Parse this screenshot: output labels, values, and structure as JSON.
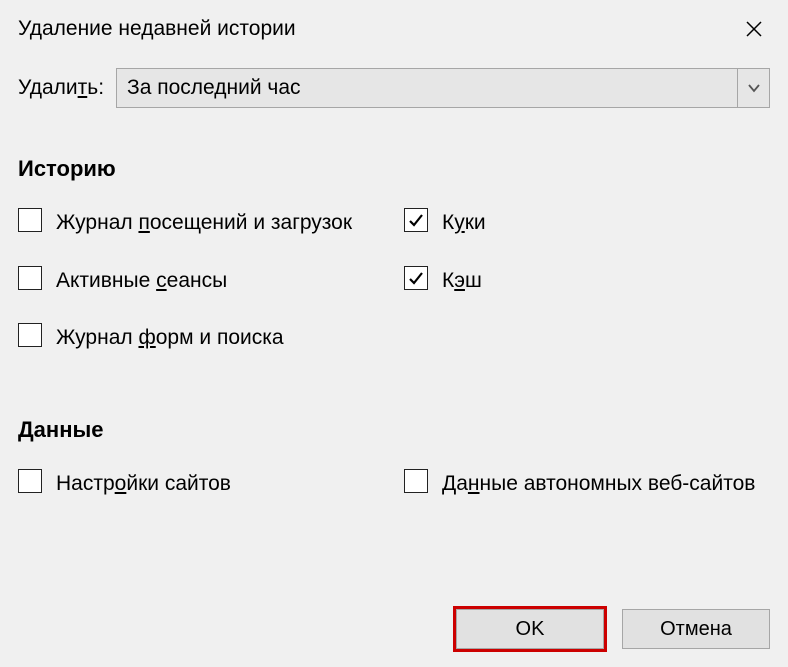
{
  "dialog": {
    "title": "Удаление недавней истории",
    "delete_label": "Удалить:",
    "range_value": "За последний час"
  },
  "sections": {
    "history_title": "Историю",
    "data_title": "Данные"
  },
  "checkboxes": {
    "browsing": {
      "label": "Журнал посещений и загрузок",
      "underline_char": "п",
      "checked": false
    },
    "sessions": {
      "label": "Активные сеансы",
      "underline_char": "с",
      "checked": false
    },
    "forms": {
      "label": "Журнал форм и поиска",
      "underline_char": "ф",
      "checked": false
    },
    "cookies": {
      "label": "Куки",
      "underline_char": "у",
      "checked": true
    },
    "cache": {
      "label": "Кэш",
      "underline_char": "э",
      "checked": true
    },
    "site_settings": {
      "label": "Настройки сайтов",
      "underline_char": "о",
      "checked": false
    },
    "offline": {
      "label": "Данные автономных веб-сайтов",
      "underline_char": "н",
      "checked": false
    }
  },
  "buttons": {
    "ok": "OK",
    "cancel": "Отмена"
  }
}
